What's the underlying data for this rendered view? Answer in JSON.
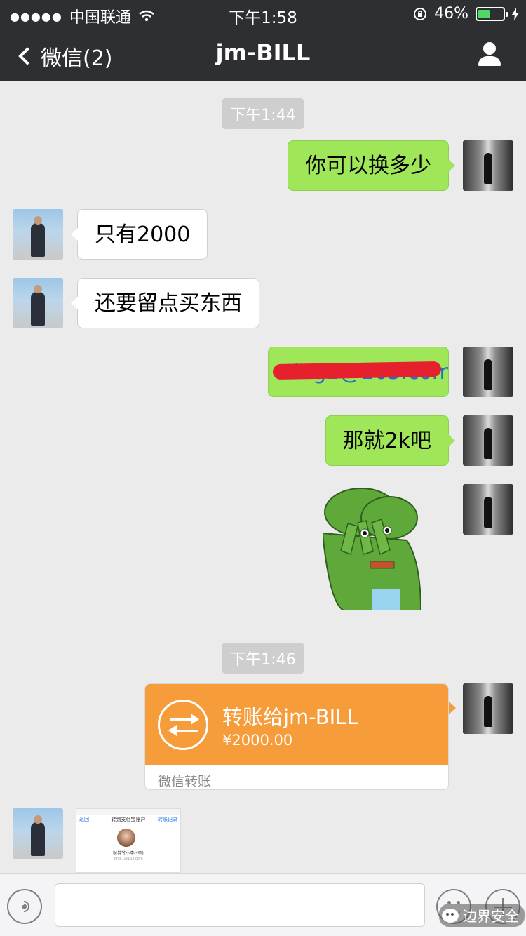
{
  "status_bar": {
    "signal_dots": "●●●●●",
    "carrier": "中国联通",
    "time": "下午1:58",
    "battery_percent": "46%",
    "battery_level": 0.46
  },
  "nav": {
    "back_label": "微信(2)",
    "title": "jm-BILL"
  },
  "chat": {
    "timestamps": [
      "下午1:44",
      "下午1:46"
    ],
    "messages": [
      {
        "side": "me",
        "text": "你可以换多少"
      },
      {
        "side": "other",
        "text": "只有2000"
      },
      {
        "side": "other",
        "text": "还要留点买东西"
      },
      {
        "side": "me",
        "text": "ting2@163.com",
        "redacted": true
      },
      {
        "side": "me",
        "text": "那就2k吧"
      },
      {
        "side": "me",
        "type": "sticker"
      }
    ],
    "transfer": {
      "title": "转账给jm-BILL",
      "amount": "¥2000.00",
      "footer": "微信转账"
    },
    "screenshot_thumb": {
      "back": "返回",
      "title": "转到支付宝账户",
      "right": "转账记录",
      "name": "财神爷小李(*李)",
      "sub": "ting...@163.com"
    }
  },
  "watermark": "边界安全"
}
